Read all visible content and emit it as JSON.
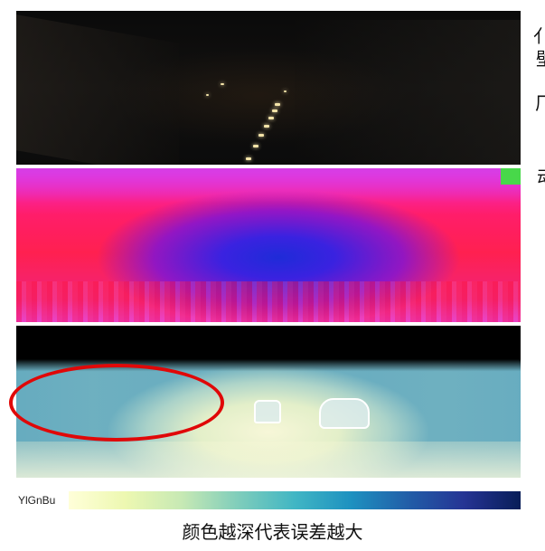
{
  "panels": {
    "top": "night-road-camera-image",
    "middle": "colored-flow-error-map",
    "bottom": "depth-error-heatmap"
  },
  "side_text": [
    "亻",
    "壁",
    "厂",
    "动"
  ],
  "colorbar": {
    "label": "YlGnBu",
    "colors": [
      "#ffffd9",
      "#edf8b1",
      "#c7e9b4",
      "#7fcdbb",
      "#41b6c4",
      "#1d91c0",
      "#225ea8",
      "#253494",
      "#081d58"
    ]
  },
  "caption": "颜色越深代表误差越大",
  "highlight_color": "#e00808"
}
